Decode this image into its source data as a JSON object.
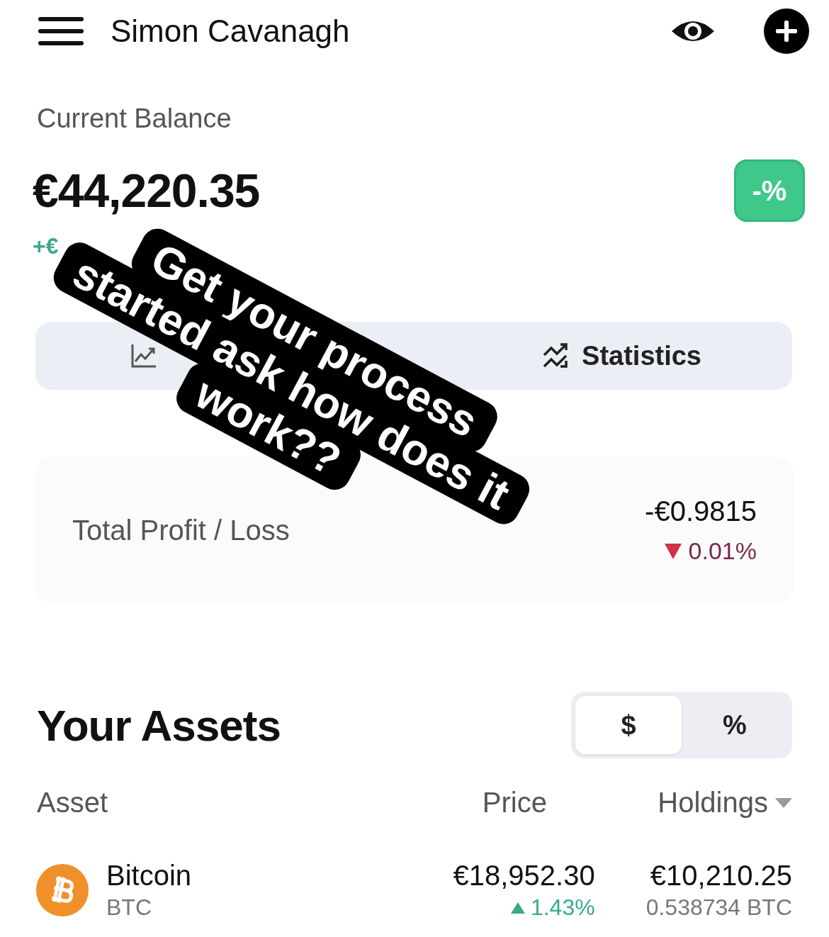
{
  "header": {
    "title": "Simon Cavanagh"
  },
  "balance": {
    "label": "Current Balance",
    "amount": "€44,220.35",
    "change": "+€",
    "percent_button": "-%"
  },
  "tabs": [
    {
      "kind": "chart"
    },
    {
      "kind": "stats",
      "label": "Statistics"
    }
  ],
  "profit_card": {
    "label": "Total Profit / Loss",
    "value": "-€0.9815",
    "change": "0.01%",
    "rising": false
  },
  "assets": {
    "title": "Your Assets",
    "toggle": [
      {
        "label": "$",
        "selected": true
      },
      {
        "label": "%",
        "selected": false
      }
    ],
    "columns": [
      "Asset",
      "Price",
      "Holdings"
    ],
    "rows": [
      {
        "name": "Bitcoin",
        "symbol": "BTC",
        "price": "€18,952.30",
        "change": "1.43%",
        "rising": true,
        "value": "€10,210.25",
        "amount": "0.538734 BTC"
      }
    ]
  },
  "overlay": {
    "lines": [
      "Get your process",
      "started ask how does it",
      "work??"
    ]
  }
}
